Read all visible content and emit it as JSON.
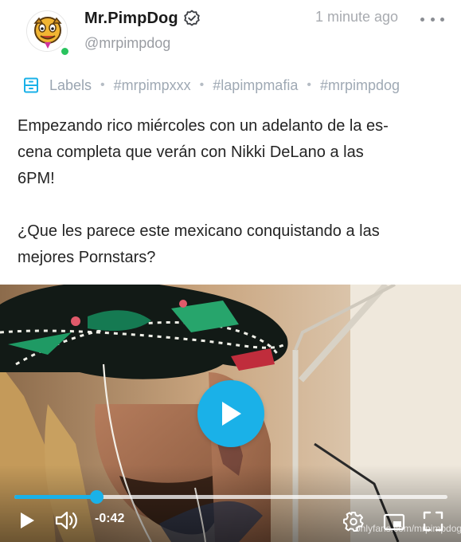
{
  "post": {
    "author": {
      "display_name": "Mr.PimpDog",
      "username": "@mrpimpdog",
      "verified": true,
      "online": true
    },
    "timestamp": "1 minute ago",
    "labels": {
      "icon": "labels-icon",
      "label_text": "Labels",
      "tags": [
        "#mrpimpxxx",
        "#lapimpmafia",
        "#mrpimpdog"
      ]
    },
    "text": {
      "line1": "Empezando rico miércoles con un adelanto de la es-",
      "line2": "cena completa que verán con Nikki DeLano a las",
      "line3": "6PM!",
      "line4": "¿Que les parece este mexicano conquistando a las",
      "line5": "mejores Pornstars?"
    }
  },
  "video": {
    "time_remaining": "-0:42",
    "progress_fraction": 0.19,
    "watermark": "onlyfans.com/mrpimpdog",
    "controls": [
      "play-icon",
      "volume-icon",
      "settings-icon",
      "picture-in-picture-icon",
      "fullscreen-icon"
    ]
  },
  "colors": {
    "accent": "#1ab1e8",
    "online": "#29c35e",
    "muted_text": "#9a9da3"
  }
}
